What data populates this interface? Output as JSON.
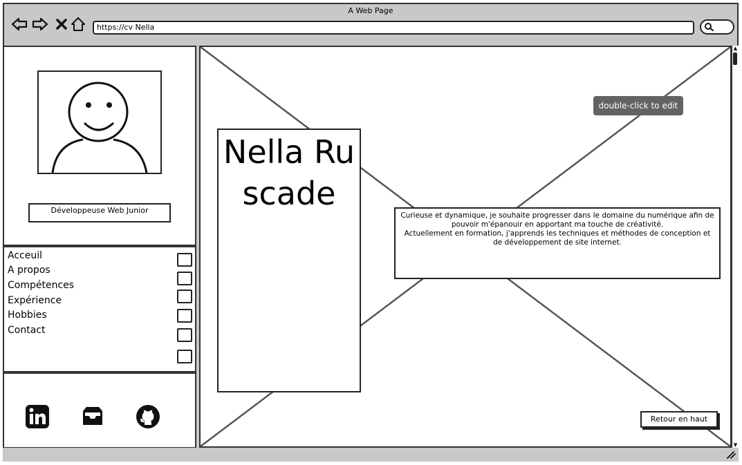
{
  "window": {
    "title": "A Web Page"
  },
  "browser": {
    "url": "https://cv Nella",
    "icons": [
      "back-arrow-icon",
      "forward-arrow-icon",
      "close-x-icon",
      "home-icon",
      "search-icon"
    ]
  },
  "profile": {
    "role": "Développeuse Web Junior"
  },
  "nav": {
    "items": [
      {
        "label": "Acceuil"
      },
      {
        "label": "A propos"
      },
      {
        "label": "Compétences"
      },
      {
        "label": "Expérience"
      },
      {
        "label": "Hobbies"
      },
      {
        "label": "Contact"
      }
    ]
  },
  "social": {
    "icons": [
      "linkedin-icon",
      "inbox-icon",
      "github-icon"
    ]
  },
  "main": {
    "name": "Nella Ruscade",
    "bio": "Curieuse et dynamique, je souhaite progresser dans le domaine du numérique afin de pouvoir m'épanouir en apportant ma touche de créativité.\nActuellement en formation, j'apprends les techniques et méthodes de conception et de développement de site internet.",
    "tooltip": "double-click to edit",
    "back_to_top": "Retour en haut"
  },
  "colors": {
    "tooltip_bg": "#636363",
    "frame": "#c8c8c8"
  }
}
